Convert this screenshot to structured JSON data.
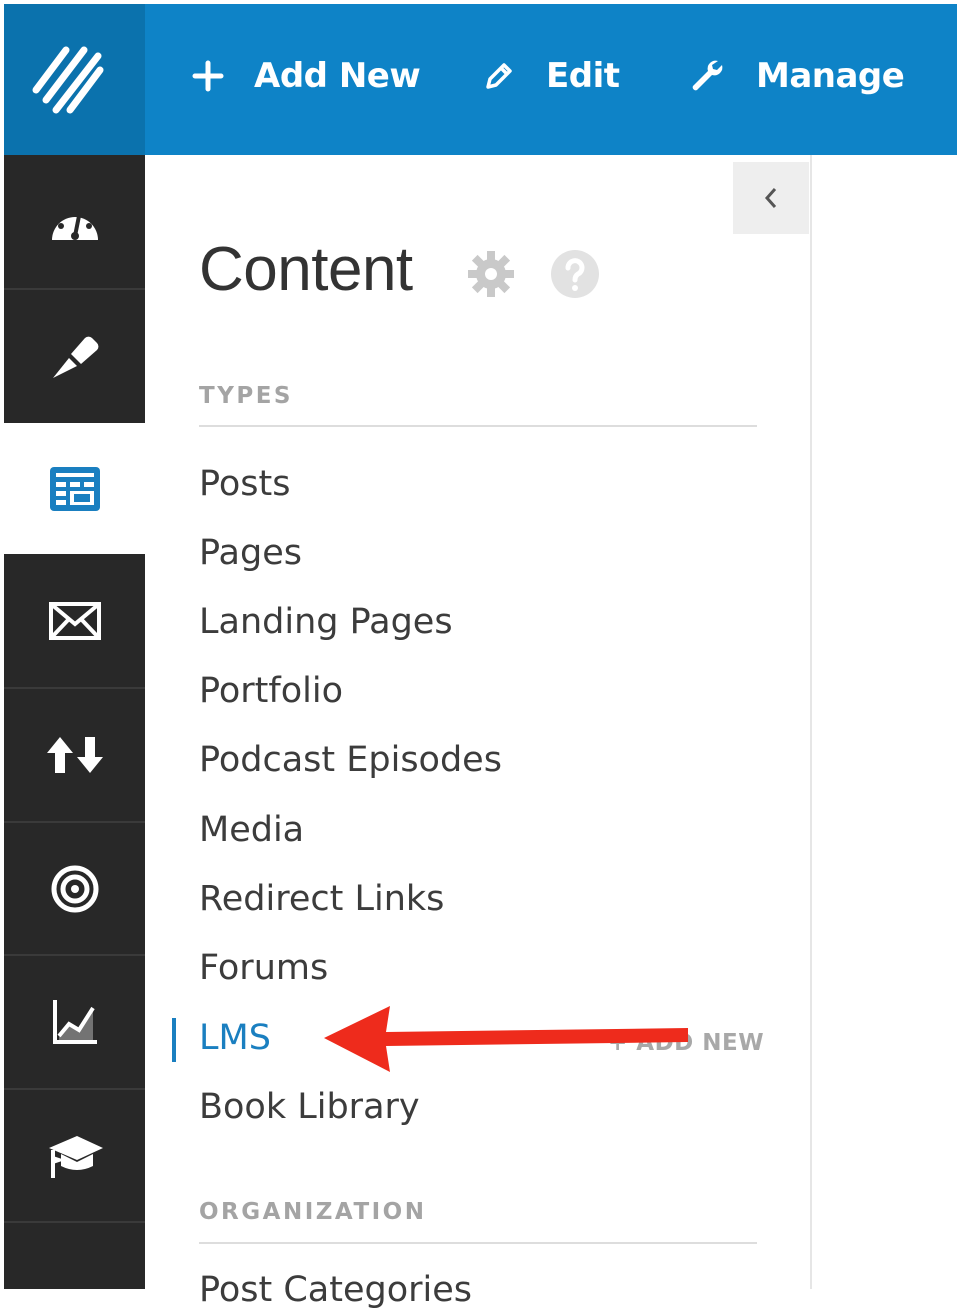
{
  "topbar": {
    "logo_icon": "logo-slashes-icon",
    "actions": [
      {
        "icon": "plus-icon",
        "label": "Add New"
      },
      {
        "icon": "pencil-icon",
        "label": "Edit"
      },
      {
        "icon": "wrench-icon",
        "label": "Manage"
      }
    ],
    "color": "#0e83c7"
  },
  "rail": {
    "items": [
      {
        "icon": "dashboard-gauge-icon"
      },
      {
        "icon": "paintbrush-icon"
      },
      {
        "icon": "content-layout-icon",
        "active": true
      },
      {
        "icon": "envelope-icon"
      },
      {
        "icon": "up-down-arrows-icon"
      },
      {
        "icon": "target-icon"
      },
      {
        "icon": "analytics-chart-icon"
      },
      {
        "icon": "graduation-cap-icon"
      }
    ]
  },
  "panel": {
    "title": "Content",
    "settings_icon": "gear-icon",
    "help_icon": "help-icon",
    "collapse_icon": "chevron-left-icon",
    "types_heading": "TYPES",
    "types": [
      "Posts",
      "Pages",
      "Landing Pages",
      "Portfolio",
      "Podcast Episodes",
      "Media",
      "Redirect Links",
      "Forums",
      "LMS",
      "Book Library"
    ],
    "active_type": "LMS",
    "add_new_label": "+ ADD NEW",
    "organization_heading": "ORGANIZATION",
    "next_item_partial": "Post Categories"
  },
  "annotation": {
    "icon": "red-arrow-icon",
    "color": "#ee2b1c"
  },
  "colors": {
    "accent": "#1a7fc0",
    "rail": "#282828"
  }
}
